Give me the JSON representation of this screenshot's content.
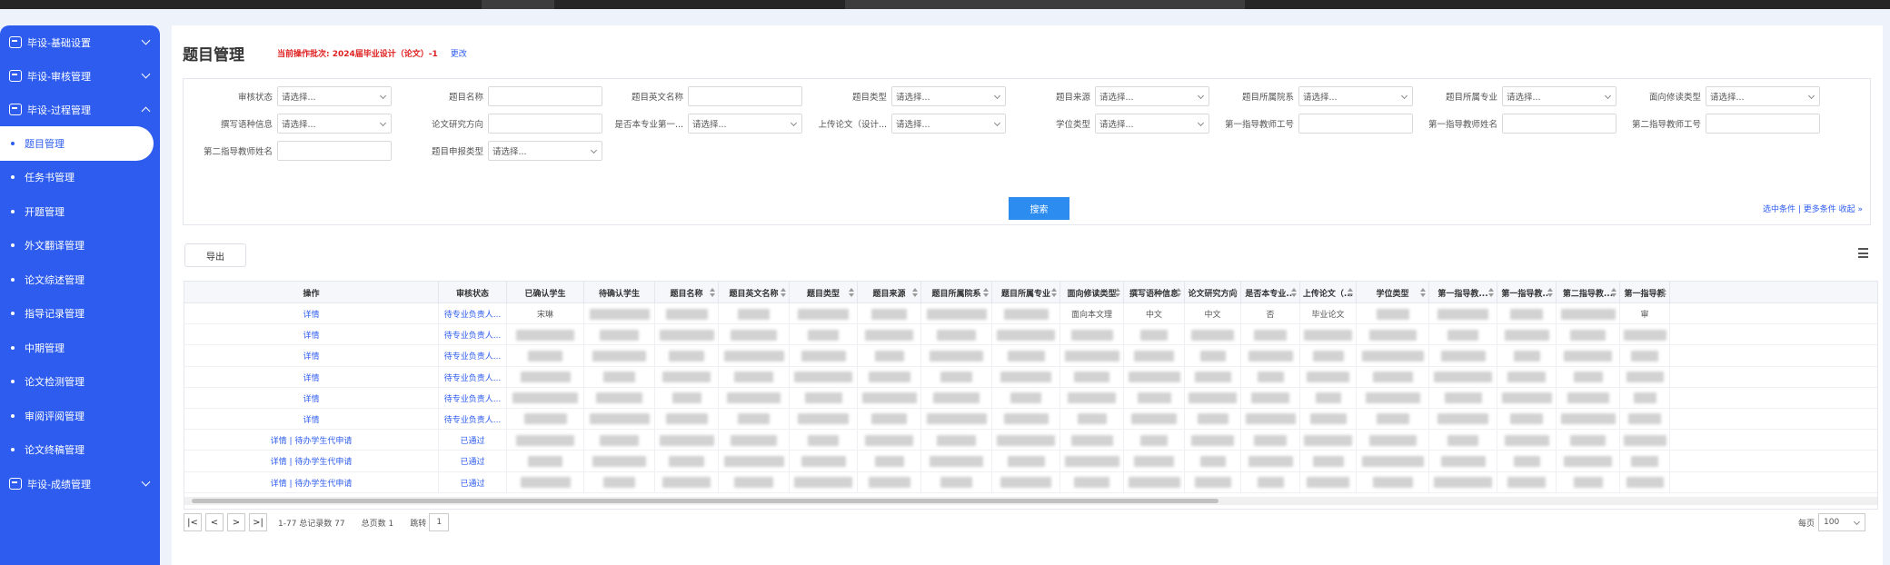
{
  "sidebar": {
    "groups": [
      {
        "label": "毕设-基础设置"
      },
      {
        "label": "毕设-审核管理"
      },
      {
        "label": "毕设-过程管理"
      },
      {
        "label": "毕设-成绩管理"
      }
    ],
    "items": [
      {
        "label": "题目管理"
      },
      {
        "label": "任务书管理"
      },
      {
        "label": "开题管理"
      },
      {
        "label": "外文翻译管理"
      },
      {
        "label": "论文综述管理"
      },
      {
        "label": "指导记录管理"
      },
      {
        "label": "中期管理"
      },
      {
        "label": "论文检测管理"
      },
      {
        "label": "审阅评阅管理"
      },
      {
        "label": "论文终稿管理"
      }
    ]
  },
  "header": {
    "title": "题目管理",
    "batch": "当前操作批次: 2024届毕业设计（论文）-1",
    "switch_label": "更改"
  },
  "filters": [
    {
      "label": "审核状态",
      "value": "请选择...",
      "dropdown": true
    },
    {
      "label": "题目名称",
      "value": "",
      "dropdown": false
    },
    {
      "label": "题目英文名称",
      "value": "",
      "dropdown": false
    },
    {
      "label": "题目类型",
      "value": "请选择...",
      "dropdown": true
    },
    {
      "label": "题目来源",
      "value": "请选择...",
      "dropdown": true
    },
    {
      "label": "题目所属院系",
      "value": "请选择...",
      "dropdown": true
    },
    {
      "label": "题目所属专业",
      "value": "请选择...",
      "dropdown": true
    },
    {
      "label": "面向修读类型",
      "value": "请选择...",
      "dropdown": true
    },
    {
      "label": "撰写语种信息",
      "value": "请选择...",
      "dropdown": true
    },
    {
      "label": "论文研究方向",
      "value": "",
      "dropdown": false
    },
    {
      "label": "是否本专业第一...",
      "value": "请选择...",
      "dropdown": true
    },
    {
      "label": "上传论文（设计...",
      "value": "请选择...",
      "dropdown": true
    },
    {
      "label": "学位类型",
      "value": "请选择...",
      "dropdown": true
    },
    {
      "label": "第一指导教师工号",
      "value": "",
      "dropdown": false
    },
    {
      "label": "第一指导教师姓名",
      "value": "",
      "dropdown": false
    },
    {
      "label": "第二指导教师工号",
      "value": "",
      "dropdown": false
    },
    {
      "label": "第二指导教师姓名",
      "value": "",
      "dropdown": false
    },
    {
      "label": "题目申报类型",
      "value": "请选择...",
      "dropdown": true
    }
  ],
  "search_label": "搜索",
  "filter_links": "选中条件 | 更多条件   收起 »",
  "export_label": "导出",
  "table": {
    "columns": [
      {
        "label": "操作",
        "sortable": false
      },
      {
        "label": "审核状态",
        "sortable": false
      },
      {
        "label": "已确认学生",
        "sortable": false
      },
      {
        "label": "待确认学生",
        "sortable": false
      },
      {
        "label": "题目名称",
        "sortable": true
      },
      {
        "label": "题目英文名称",
        "sortable": true
      },
      {
        "label": "题目类型",
        "sortable": true
      },
      {
        "label": "题目来源",
        "sortable": true
      },
      {
        "label": "题目所属院系",
        "sortable": true
      },
      {
        "label": "题目所属专业",
        "sortable": true
      },
      {
        "label": "面向修读类型",
        "sortable": true
      },
      {
        "label": "撰写语种信息",
        "sortable": true
      },
      {
        "label": "论文研究方向",
        "sortable": true
      },
      {
        "label": "是否本专业...",
        "sortable": true
      },
      {
        "label": "上传论文（...",
        "sortable": true
      },
      {
        "label": "学位类型",
        "sortable": true
      },
      {
        "label": "第一指导教...",
        "sortable": true
      },
      {
        "label": "第一指导教...",
        "sortable": true
      },
      {
        "label": "第二指导教...",
        "sortable": true
      },
      {
        "label": "第一指导教",
        "sortable": true
      }
    ],
    "rows": [
      {
        "action": "详情",
        "status": "待专业负责人...",
        "confirmed": "宋琳",
        "lang": "中文",
        "dir": "中文",
        "major_first": "否",
        "upload": "毕业论文",
        "pending": "审",
        "kind": "面向本文理"
      },
      {
        "action": "详情",
        "status": "待专业负责人...",
        "confirmed": "",
        "lang": "",
        "dir": "",
        "major_first": "",
        "upload": "",
        "pending": "",
        "kind": ""
      },
      {
        "action": "详情",
        "status": "待专业负责人...",
        "confirmed": "",
        "lang": "",
        "dir": "",
        "major_first": "",
        "upload": "",
        "pending": "",
        "kind": ""
      },
      {
        "action": "详情",
        "status": "待专业负责人...",
        "confirmed": "",
        "lang": "",
        "dir": "",
        "major_first": "",
        "upload": "",
        "pending": "",
        "kind": ""
      },
      {
        "action": "详情",
        "status": "待专业负责人...",
        "confirmed": "",
        "lang": "",
        "dir": "",
        "major_first": "",
        "upload": "",
        "pending": "",
        "kind": ""
      },
      {
        "action": "详情",
        "status": "待专业负责人...",
        "confirmed": "",
        "lang": "",
        "dir": "",
        "major_first": "",
        "upload": "",
        "pending": "",
        "kind": ""
      },
      {
        "action": "详情 | 待办学生代申请",
        "status": "已通过",
        "confirmed": "",
        "lang": "",
        "dir": "",
        "major_first": "",
        "upload": "",
        "pending": "",
        "kind": ""
      },
      {
        "action": "详情 | 待办学生代申请",
        "status": "已通过",
        "confirmed": "",
        "lang": "",
        "dir": "",
        "major_first": "",
        "upload": "",
        "pending": "",
        "kind": ""
      },
      {
        "action": "详情 | 待办学生代申请",
        "status": "已通过",
        "confirmed": "",
        "lang": "",
        "dir": "",
        "major_first": "",
        "upload": "",
        "pending": "",
        "kind": ""
      }
    ]
  },
  "pager": {
    "buttons": [
      "|<",
      "<",
      ">",
      ">|"
    ],
    "range": "1-77 总记录数 77",
    "total_pages": "总页数 1",
    "jump_label": "跳转",
    "page": "1",
    "per_page_label": "每页",
    "per_page": "100"
  }
}
